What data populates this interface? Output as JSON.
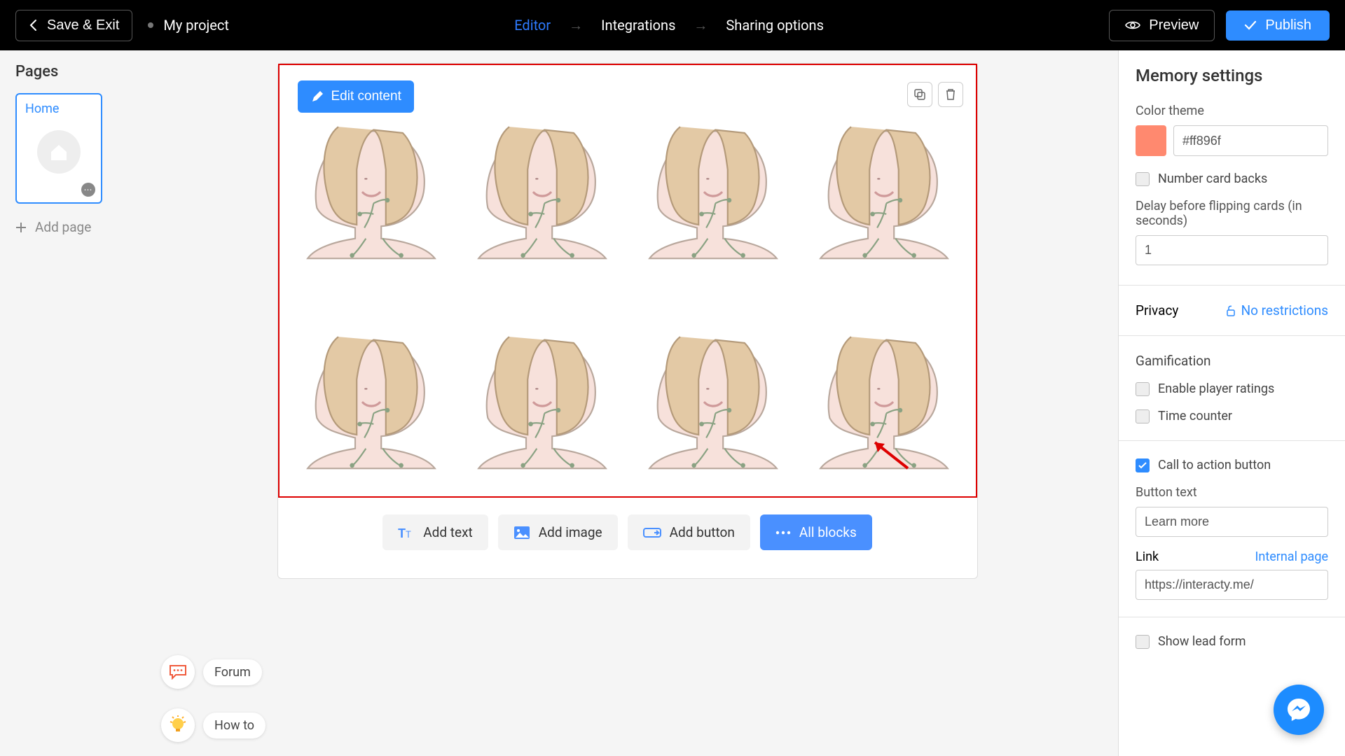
{
  "header": {
    "save_exit": "Save & Exit",
    "project_name": "My project",
    "steps": {
      "editor": "Editor",
      "integrations": "Integrations",
      "sharing": "Sharing options"
    },
    "preview": "Preview",
    "publish": "Publish"
  },
  "sidebar": {
    "title": "Pages",
    "pages": [
      {
        "label": "Home"
      }
    ],
    "add_page": "Add page"
  },
  "canvas": {
    "edit_content": "Edit content",
    "add_text": "Add text",
    "add_image": "Add image",
    "add_button": "Add button",
    "all_blocks": "All blocks"
  },
  "help": {
    "forum": "Forum",
    "howto": "How to"
  },
  "panel": {
    "title": "Memory settings",
    "color_theme_label": "Color theme",
    "color_value": "#ff896f",
    "number_card_backs": "Number card backs",
    "delay_label": "Delay before flipping cards (in seconds)",
    "delay_value": "1",
    "privacy_label": "Privacy",
    "privacy_value": "No restrictions",
    "gamification_label": "Gamification",
    "enable_ratings": "Enable player ratings",
    "time_counter": "Time counter",
    "cta_toggle": "Call to action button",
    "button_text_label": "Button text",
    "button_text_value": "Learn more",
    "link_label": "Link",
    "internal_page": "Internal page",
    "link_value": "https://interacty.me/",
    "show_lead_form": "Show lead form"
  }
}
